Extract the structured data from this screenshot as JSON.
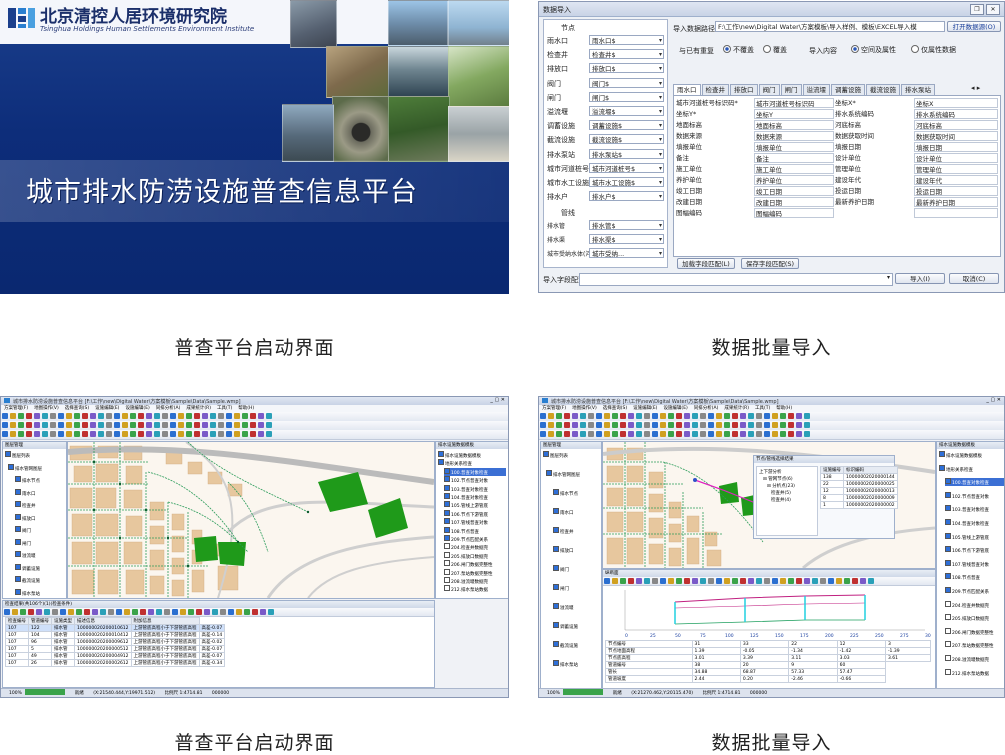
{
  "splash": {
    "org_cn": "北京清控人居环境研究院",
    "org_en": "Tsinghua Holdings Human Settlements Environment Institute",
    "title": "城市排水防涝设施普查信息平台"
  },
  "dialog": {
    "title": "数据导入",
    "left_header": "节点",
    "left_rows": [
      {
        "label": "雨水口",
        "value": "雨水口$"
      },
      {
        "label": "检查井",
        "value": "检查井$"
      },
      {
        "label": "排放口",
        "value": "排放口$"
      },
      {
        "label": "阀门",
        "value": "阀门$"
      },
      {
        "label": "闸门",
        "value": "闸门$"
      },
      {
        "label": "溢流堰",
        "value": "溢流堰$"
      },
      {
        "label": "调蓄设施",
        "value": "调蓄设施$"
      },
      {
        "label": "截流设施",
        "value": "截流设施$"
      },
      {
        "label": "排水泵站",
        "value": "排水泵站$"
      },
      {
        "label": "城市河道桩号",
        "value": "城市河道桩号$"
      },
      {
        "label": "城市水工设施",
        "value": "城市水工设施$"
      },
      {
        "label": "排水户",
        "value": "排水户$"
      }
    ],
    "left_header2": "管线",
    "left_rows2": [
      {
        "label": "排水管",
        "value": "排水管$"
      },
      {
        "label": "排水渠",
        "value": "排水渠$"
      },
      {
        "label": "城市受纳水体(河道)",
        "value": "城市受纳..."
      }
    ],
    "path_label": "导入数据路径:",
    "path_value": "F:\\工作\\new\\Digital Water\\方案模板\\导入样例、模板\\EXCEL导入模",
    "open_button": "打开数据源(O)",
    "overlap_label": "与已有重复",
    "opt_no_overwrite": "不覆盖",
    "opt_overwrite": "覆盖",
    "content_label": "导入内容",
    "opt_empty": "空间及属性",
    "opt_attr": "仅属性数据",
    "tabs": [
      "雨水口",
      "检查井",
      "排放口",
      "阀门",
      "闸门",
      "溢流堰",
      "调蓄设施",
      "截流设施",
      "排水泵站"
    ],
    "grid_rows": [
      [
        "城市河道桩号标识码*",
        "城市河道桩号标识码",
        "坐标X*",
        "坐标X"
      ],
      [
        "坐标Y*",
        "坐标Y",
        "排水系统编码",
        "排水系统编码"
      ],
      [
        "地面标高",
        "地面标高",
        "河底标高",
        "河底标高"
      ],
      [
        "数据来源",
        "数据来源",
        "数据获取时间",
        "数据获取时间"
      ],
      [
        "填报单位",
        "填报单位",
        "填报日期",
        "填报日期"
      ],
      [
        "备注",
        "备注",
        "设计单位",
        "设计单位"
      ],
      [
        "施工单位",
        "施工单位",
        "管理单位",
        "管理单位"
      ],
      [
        "养护单位",
        "养护单位",
        "建设年代",
        "建设年代"
      ],
      [
        "竣工日期",
        "竣工日期",
        "投运日期",
        "投运日期"
      ],
      [
        "改建日期",
        "改建日期",
        "最新养护日期",
        "最新养护日期"
      ],
      [
        "图幅编码",
        "图幅编码",
        "",
        ""
      ]
    ],
    "load_button": "加载字段匹配(L)",
    "save_button": "保存字段匹配(S)",
    "import_label": "导入字段配置",
    "import_button": "导入(I)",
    "cancel_button": "取消(C)"
  },
  "gis1": {
    "window_title": "城市排水防涝设施普查信息平台 [F:\\工作\\new\\Digital Water\\方案模板\\Sample\\Data\\Sample.wmp]",
    "menu": [
      "方案管理(F)",
      "地图操作(V)",
      "选择查询(S)",
      "设施编辑(E)",
      "设施编辑(E)",
      "同排分析(A)",
      "成果统计(R)",
      "工具(T)",
      "帮助(H)"
    ],
    "layers_title": "图层管理",
    "layers": [
      "图层列表",
      "排水管网图层",
      "排水节点",
      "雨水口",
      "检查井",
      "排放口",
      "阀门",
      "闸门",
      "溢流堰",
      "调蓄设施",
      "截流设施",
      "排水泵站"
    ],
    "right_title": "排水设施数据模板",
    "right_items": [
      "排水设施数据模板",
      "地形关系检查",
      "100.普查对象检查",
      "102.节点普查对象",
      "103.普查对象检查",
      "104.普查对象检查",
      "105.管线上游管底",
      "106.节点下游管底",
      "107.管线普查对象",
      "108.节点普查",
      "209.节点匹配关系",
      "204.检查井数据完",
      "205.排放口数据完",
      "206.闸门数据完整性",
      "207.泵站数据完整性",
      "208.溢流堰数据完",
      "212.排水泵站数据"
    ],
    "table_title": "检查结果(共106个)(1)(检查条件)",
    "table_headers": [
      "检查编号",
      "管道编号",
      "设施类型",
      "描述信息",
      "附加信息"
    ],
    "table_rows": [
      [
        "107",
        "122",
        "排水管",
        "100000020200010612",
        "上游管底高程小于下游管底高程",
        "高差-0.07"
      ],
      [
        "107",
        "104",
        "排水管",
        "100000020200010412",
        "上游管底高程小于下游管底高程",
        "高差-0.14"
      ],
      [
        "107",
        "96",
        "排水管",
        "100000020200009612",
        "上游管底高程小于下游管底高程",
        "高差-0.02"
      ],
      [
        "107",
        "5",
        "排水管",
        "100000020200000512",
        "上游管底高程小于下游管底高程",
        "高差-0.07"
      ],
      [
        "107",
        "49",
        "排水管",
        "100000020200004912",
        "上游管底高程小于下游管底高程",
        "高差-0.07"
      ],
      [
        "107",
        "26",
        "排水管",
        "100000020200002612",
        "上游管底高程小于下游管底高程",
        "高差-0.34"
      ]
    ],
    "status_zoom": "100%",
    "status_mode": "就绪",
    "status_coord": "(X:21540.444,Y:19971.512)",
    "status_scale": "比例尺 1:4714.81",
    "status_count": "000000"
  },
  "gis2": {
    "window_title": "城市排水防涝设施普查信息平台 [F:\\工作\\new\\Digital Water\\方案模板\\Sample\\Data\\Sample.wmp]",
    "popup_title": "节点/管线选择结果",
    "popup_headers": [
      "设施编号",
      "标识编码"
    ],
    "popup_rows": [
      [
        "138",
        "10000002020000144"
      ],
      [
        "22",
        "10000002020000025"
      ],
      [
        "12",
        "10000002020000013"
      ],
      [
        "8",
        "10000002020000009"
      ],
      [
        "1",
        "10000002020000002"
      ]
    ],
    "profile_title": "纵断面",
    "x_ticks": [
      "0",
      "25",
      "50",
      "75",
      "100",
      "125",
      "150",
      "175",
      "200",
      "225",
      "250",
      "275",
      "300"
    ],
    "profile_rows": [
      {
        "label": "节点编号",
        "values": [
          "31",
          "33",
          "22",
          "12",
          "3"
        ]
      },
      {
        "label": "节点地面高程",
        "values": [
          "1.39",
          "-0.05",
          "-1.34",
          "-1.42",
          "-1.39"
        ]
      },
      {
        "label": "节点底高程",
        "values": [
          "3.01",
          "3.39",
          "3.11",
          "3.03",
          "3.61"
        ]
      },
      {
        "label": "管道编号",
        "values": [
          "38",
          "20",
          "9",
          "60"
        ]
      },
      {
        "label": "管长",
        "values": [
          "34.88",
          "68.87",
          "57.33",
          "57.47"
        ]
      },
      {
        "label": "管道坡度",
        "values": [
          "2.44",
          "0.20",
          "-2.46",
          "-0.66"
        ]
      }
    ],
    "status_zoom": "100%",
    "status_mode": "就绪",
    "status_coord": "(X:21270.462,Y:20115.470)",
    "status_scale": "比例尺 1:4714.81",
    "status_count": "000000"
  },
  "captions": {
    "top_left": "普查平台启动界面",
    "top_right": "数据批量导入",
    "bottom_left": "普查平台启动界面",
    "bottom_right": "数据批量导入"
  },
  "colors": {
    "splash_bg": "#0d2d7a",
    "map_green": "#1f9a1a",
    "map_block": "#e7c79e",
    "pipe": "#2b9c5a"
  }
}
